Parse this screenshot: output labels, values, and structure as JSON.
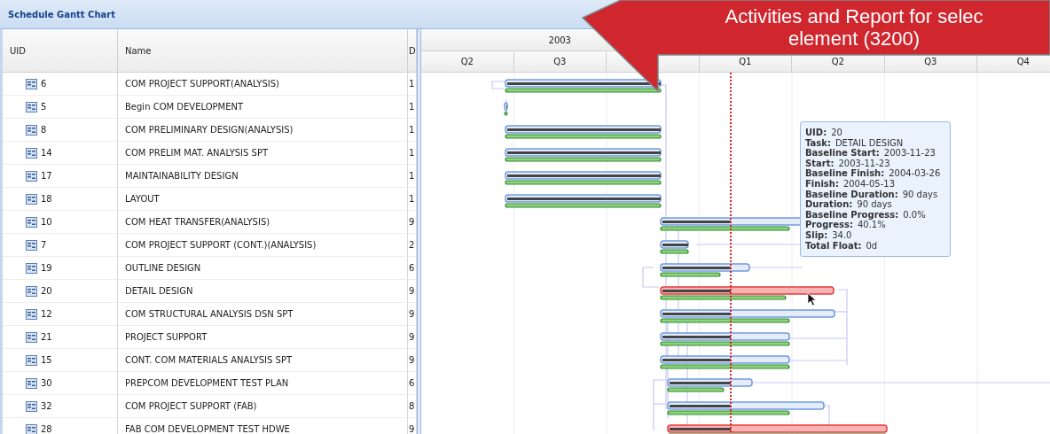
{
  "panel": {
    "title": "Schedule Gantt Chart"
  },
  "columns": [
    "UID",
    "Name",
    "D"
  ],
  "timeline": {
    "year": "2003",
    "quarters_2003": [
      "Q2",
      "Q3"
    ],
    "quarters_2004": [
      "Q1",
      "Q2",
      "Q3",
      "Q4"
    ]
  },
  "rows": [
    {
      "uid": "6",
      "name": "COM PROJECT SUPPORT(ANALYSIS)",
      "duration": "1",
      "highlighted": false
    },
    {
      "uid": "5",
      "name": "Begin COM DEVELOPMENT",
      "duration": "1",
      "highlighted": false
    },
    {
      "uid": "8",
      "name": "COM PRELIMINARY DESIGN(ANALYSIS)",
      "duration": "1",
      "highlighted": false
    },
    {
      "uid": "14",
      "name": "COM PRELIM MAT. ANALYSIS SPT",
      "duration": "1",
      "highlighted": false
    },
    {
      "uid": "17",
      "name": "MAINTAINABILITY DESIGN",
      "duration": "1",
      "highlighted": false
    },
    {
      "uid": "18",
      "name": "LAYOUT",
      "duration": "1",
      "highlighted": false
    },
    {
      "uid": "10",
      "name": "COM HEAT TRANSFER(ANALYSIS)",
      "duration": "9",
      "highlighted": false
    },
    {
      "uid": "7",
      "name": "COM PROJECT SUPPORT (CONT.)(ANALYSIS)",
      "duration": "2",
      "highlighted": false
    },
    {
      "uid": "19",
      "name": "OUTLINE DESIGN",
      "duration": "6",
      "highlighted": false
    },
    {
      "uid": "20",
      "name": "DETAIL DESIGN",
      "duration": "9",
      "highlighted": true
    },
    {
      "uid": "12",
      "name": "COM STRUCTURAL ANALYSIS DSN SPT",
      "duration": "9",
      "highlighted": false
    },
    {
      "uid": "21",
      "name": "PROJECT SUPPORT",
      "duration": "9",
      "highlighted": false
    },
    {
      "uid": "15",
      "name": "CONT. COM MATERIALS ANALYSIS SPT",
      "duration": "9",
      "highlighted": false
    },
    {
      "uid": "30",
      "name": "PREPCOM DEVELOPMENT TEST PLAN",
      "duration": "6",
      "highlighted": false
    },
    {
      "uid": "32",
      "name": "COM PROJECT SUPPORT (FAB)",
      "duration": "8",
      "highlighted": false
    },
    {
      "uid": "28",
      "name": "FAB COM DEVELOPMENT TEST HDWE",
      "duration": "9",
      "highlighted": true
    }
  ],
  "tooltip": {
    "lines": [
      {
        "label": "UID:",
        "value": "20"
      },
      {
        "label": "Task:",
        "value": "DETAIL DESIGN"
      },
      {
        "label": "Baseline Start:",
        "value": "2003-11-23"
      },
      {
        "label": "Start:",
        "value": "2003-11-23"
      },
      {
        "label": "Baseline Finish:",
        "value": "2004-03-26"
      },
      {
        "label": "Finish:",
        "value": "2004-05-13"
      },
      {
        "label": "Baseline Duration:",
        "value": "90 days"
      },
      {
        "label": "Duration:",
        "value": "90 days"
      },
      {
        "label": "Baseline Progress:",
        "value": "0.0%"
      },
      {
        "label": "Progress:",
        "value": "40.1%"
      },
      {
        "label": "Slip:",
        "value": "34.0"
      },
      {
        "label": "Total Float:",
        "value": "0d"
      }
    ]
  },
  "callout": {
    "lines": [
      "Activities and Report for selec",
      "element (3200)"
    ]
  }
}
